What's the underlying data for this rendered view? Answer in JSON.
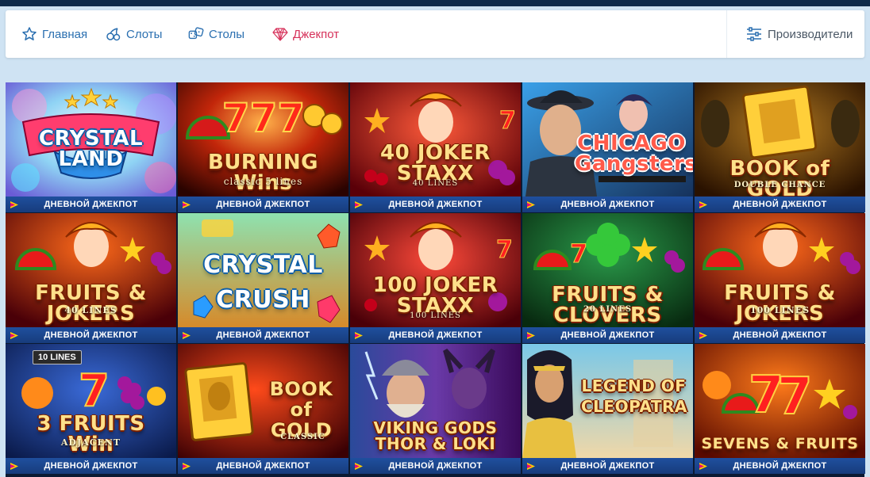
{
  "nav": {
    "items": [
      {
        "label": "Главная",
        "icon": "star-outline-icon",
        "color": "#2a6fb0"
      },
      {
        "label": "Слоты",
        "icon": "cherries-icon",
        "color": "#2a6fb0"
      },
      {
        "label": "Столы",
        "icon": "dice-icon",
        "color": "#2a6fb0"
      },
      {
        "label": "Джекпот",
        "icon": "diamond-icon",
        "color": "#d6315a"
      }
    ],
    "providers": {
      "label": "Производители",
      "icon": "sliders-icon"
    }
  },
  "colors": {
    "page_bg": "#cfe3f3",
    "top_strip": "#0e2a4a",
    "jackpot_bar": "#1f4f9e",
    "nav_accent": "#2a6fb0",
    "jackpot_accent": "#d6315a"
  },
  "games": [
    {
      "title": "CRYSTAL LAND",
      "subtitle": "",
      "badge": "ДНЕВНОЙ ДЖЕКПОТ"
    },
    {
      "title": "BURNING Wins",
      "subtitle": "classic 5 lines",
      "badge": "ДНЕВНОЙ ДЖЕКПОТ"
    },
    {
      "title": "40 JOKER STAXX",
      "subtitle": "40 LINES",
      "badge": "ДНЕВНОЙ ДЖЕКПОТ"
    },
    {
      "title": "CHICAGO Gangsters",
      "subtitle": "",
      "badge": "ДНЕВНОЙ ДЖЕКПОТ"
    },
    {
      "title": "BOOK of GOLD",
      "subtitle": "DOUBLE CHANCE",
      "badge": "ДНЕВНОЙ ДЖЕКПОТ"
    },
    {
      "title": "FRUITS & JOKERS",
      "subtitle": "40 LINES",
      "badge": "ДНЕВНОЙ ДЖЕКПОТ"
    },
    {
      "title": "CRYSTAL CRUSH",
      "subtitle": "",
      "badge": "ДНЕВНОЙ ДЖЕКПОТ"
    },
    {
      "title": "100 JOKER STAXX",
      "subtitle": "100 LINES",
      "badge": "ДНЕВНОЙ ДЖЕКПОТ"
    },
    {
      "title": "FRUITS & CLOVERS",
      "subtitle": "20 LINES",
      "badge": "ДНЕВНОЙ ДЖЕКПОТ"
    },
    {
      "title": "FRUITS & JOKERS",
      "subtitle": "100 LINES",
      "badge": "ДНЕВНОЙ ДЖЕКПОТ"
    },
    {
      "title": "3 FRUITS Win",
      "subtitle": "ADJACENT",
      "badge": "ДНЕВНОЙ ДЖЕКПОТ"
    },
    {
      "title": "BOOK of GOLD",
      "subtitle": "CLASSIC",
      "badge": "ДНЕВНОЙ ДЖЕКПОТ"
    },
    {
      "title": "VIKING GODS THOR & LOKI",
      "subtitle": "",
      "badge": "ДНЕВНОЙ ДЖЕКПОТ"
    },
    {
      "title": "LEGEND OF CLEOPATRA",
      "subtitle": "",
      "badge": "ДНЕВНОЙ ДЖЕКПОТ"
    },
    {
      "title": "SEVENS & FRUITS",
      "subtitle": "",
      "badge": "ДНЕВНОЙ ДЖЕКПОТ"
    }
  ],
  "tile_badges": {
    "10": "10 LINES"
  }
}
